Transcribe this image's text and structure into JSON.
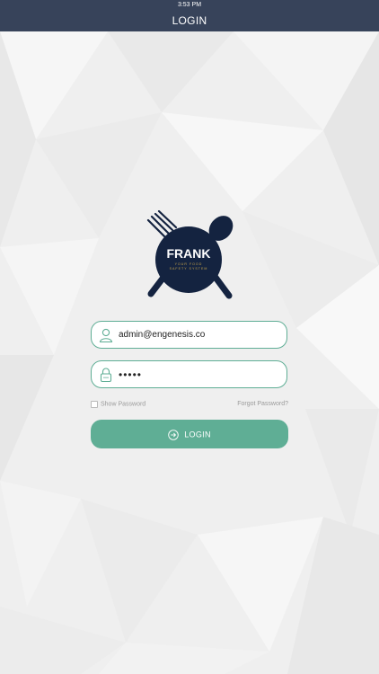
{
  "status_bar": {
    "time": "3:53 PM"
  },
  "nav": {
    "title": "LOGIN"
  },
  "logo": {
    "brand": "FRANK",
    "tagline_line1": "YOUR FOOD",
    "tagline_line2": "SAFETY SYSTEM",
    "icon": "fork-and-spoon-plate-logo"
  },
  "form": {
    "email_value": "admin@engenesis.co",
    "email_icon": "user-icon",
    "password_value": "•••••",
    "password_icon": "lock-icon",
    "show_password_label": "Show Password",
    "show_password_checked": false,
    "forgot_password_label": "Forgot Password?",
    "login_button_label": "LOGIN",
    "login_button_icon": "arrow-right-circle-icon"
  },
  "colors": {
    "nav_bg": "#37435a",
    "accent": "#5fae95",
    "logo_navy": "#142340",
    "tagline_gold": "#c9a54a"
  }
}
